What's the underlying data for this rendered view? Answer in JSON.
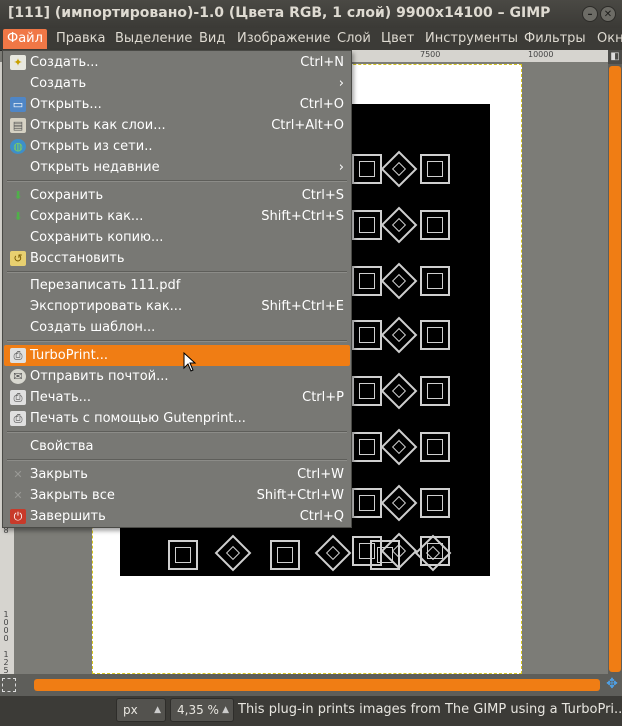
{
  "window": {
    "title": "[111] (импортировано)-1.0 (Цвета RGB, 1 слой) 9900x14100 – GIMP",
    "minimize_glyph": "–",
    "close_glyph": "✕"
  },
  "menubar": {
    "items": [
      "Файл",
      "Правка",
      "Выделение",
      "Вид",
      "Изображение",
      "Слой",
      "Цвет",
      "Инструменты",
      "Фильтры",
      "Окн"
    ]
  },
  "ruler": {
    "top_labels": [
      "7500",
      "10000"
    ],
    "left_labels": [
      "8",
      "1",
      "0",
      "0",
      "0",
      "1",
      "2",
      "5",
      "0",
      "0"
    ]
  },
  "file_menu": {
    "items": [
      {
        "label": "Создать...",
        "shortcut": "Ctrl+N",
        "icon": "new-document-icon"
      },
      {
        "label": "Создать",
        "submenu": "›"
      },
      {
        "label": "Открыть...",
        "shortcut": "Ctrl+O",
        "icon": "open-folder-icon"
      },
      {
        "label": "Открыть как слои...",
        "shortcut": "Ctrl+Alt+O",
        "icon": "open-as-layers-icon"
      },
      {
        "label": "Открыть из сети..",
        "icon": "globe-icon"
      },
      {
        "label": "Открыть недавние",
        "submenu": "›"
      },
      {
        "label": "Сохранить",
        "shortcut": "Ctrl+S",
        "icon": "save-icon"
      },
      {
        "label": "Сохранить как...",
        "shortcut": "Shift+Ctrl+S",
        "icon": "save-as-icon"
      },
      {
        "label": "Сохранить копию..."
      },
      {
        "label": "Восстановить",
        "icon": "revert-icon"
      },
      {
        "label": "Перезаписать 111.pdf"
      },
      {
        "label": "Экспортировать как...",
        "shortcut": "Shift+Ctrl+E"
      },
      {
        "label": "Создать шаблон..."
      },
      {
        "label": "TurboPrint...",
        "icon": "printer-icon",
        "highlighted": true
      },
      {
        "label": "Отправить почтой...",
        "icon": "mail-icon"
      },
      {
        "label": "Печать...",
        "shortcut": "Ctrl+P",
        "icon": "printer-icon"
      },
      {
        "label": "Печать с помощью Gutenprint...",
        "icon": "printer-icon"
      },
      {
        "label": "Свойства"
      },
      {
        "label": "Закрыть",
        "shortcut": "Ctrl+W",
        "icon": "close-icon"
      },
      {
        "label": "Закрыть все",
        "shortcut": "Shift+Ctrl+W",
        "icon": "close-all-icon"
      },
      {
        "label": "Завершить",
        "shortcut": "Ctrl+Q",
        "icon": "quit-icon"
      }
    ]
  },
  "statusbar": {
    "unit": "px",
    "zoom": "4,35 %",
    "message": "This plug-in prints images from The GIMP using a TurboPri..."
  },
  "colors": {
    "accent": "#f07d14",
    "menu_active": "#f07746",
    "menu_bg": "#787874"
  }
}
